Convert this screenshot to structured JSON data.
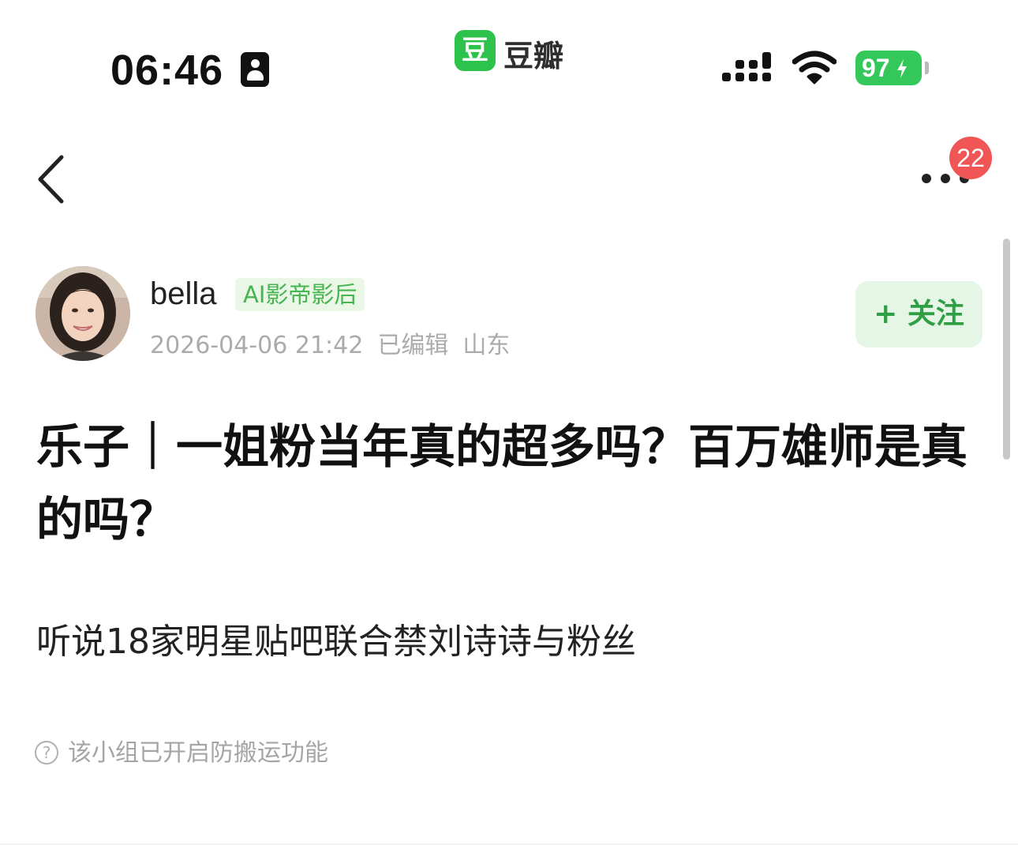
{
  "status_bar": {
    "time": "06:46",
    "app_logo_char": "豆",
    "app_name": "豆瓣",
    "battery": "97",
    "battery_color": "#34c759"
  },
  "nav": {
    "back_icon": "chevron-left-icon",
    "more_icon": "more-horizontal-icon",
    "notification_count": "22"
  },
  "post": {
    "author": {
      "name": "bella",
      "tag": "AI影帝影后"
    },
    "meta": {
      "datetime": "2026-04-06 21:42",
      "edited": "已编辑",
      "location": "山东"
    },
    "follow_label": "+ 关注",
    "title": "乐子｜一姐粉当年真的超多吗？百万雄师是真的吗？",
    "body": "听说18家明星贴吧联合禁刘诗诗与粉丝",
    "notice": "该小组已开启防搬运功能"
  },
  "colors": {
    "accent_green": "#2dc24b",
    "badge_red": "#f05656",
    "tag_bg": "#eaf7e6"
  }
}
